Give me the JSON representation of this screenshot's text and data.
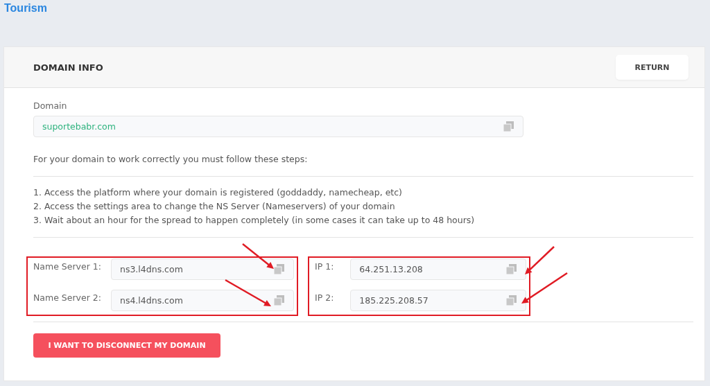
{
  "page_title": "Tourism",
  "card": {
    "title": "DOMAIN INFO",
    "return_button": "RETURN"
  },
  "domain": {
    "label": "Domain",
    "value": "suportebabr.com"
  },
  "intro": "For your domain to work correctly you must follow these steps:",
  "steps": [
    "1. Access the platform where your domain is registered (goddaddy, namecheap, etc)",
    "2. Access the settings area to change the NS Server (Nameservers) of your domain",
    "3. Wait about an hour for the spread to happen completely (in some cases it can take up to 48 hours)"
  ],
  "name_servers": [
    {
      "label": "Name Server 1:",
      "value": "ns3.l4dns.com"
    },
    {
      "label": "Name Server 2:",
      "value": "ns4.l4dns.com"
    }
  ],
  "ips": [
    {
      "label": "IP 1:",
      "value": "64.251.13.208"
    },
    {
      "label": "IP 2:",
      "value": "185.225.208.57"
    }
  ],
  "disconnect_button": "I WANT TO DISCONNECT MY DOMAIN"
}
